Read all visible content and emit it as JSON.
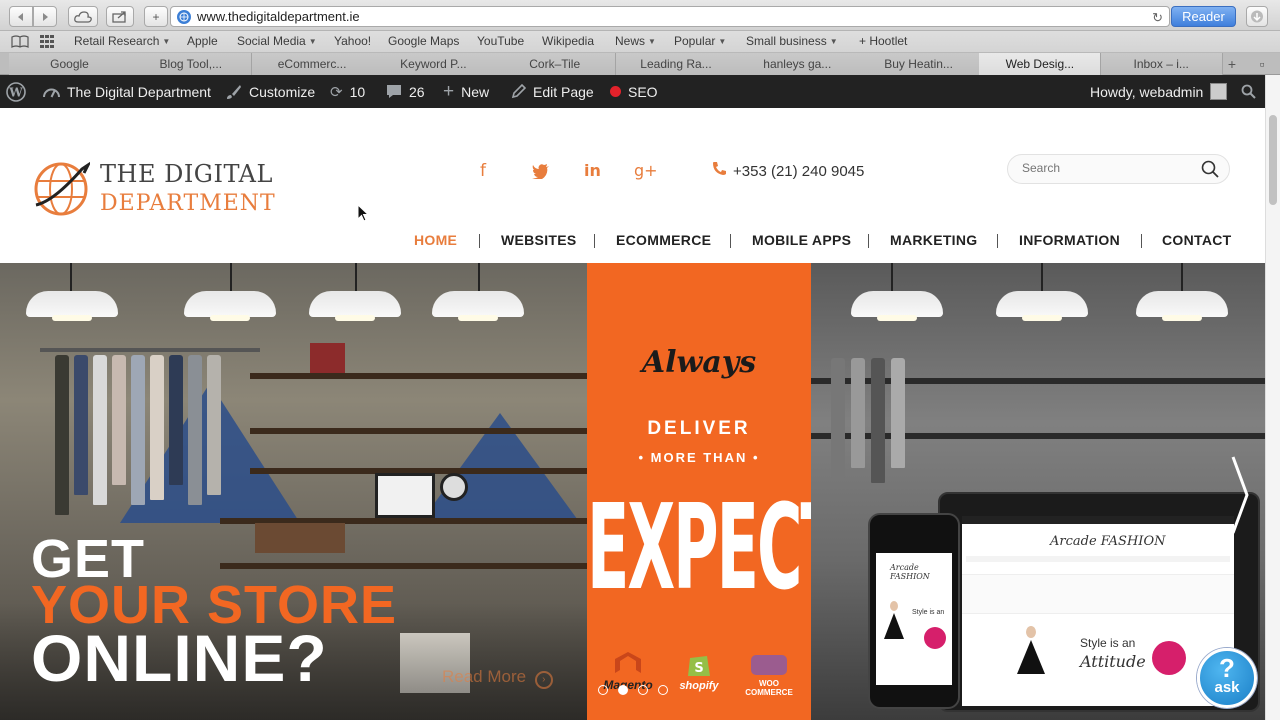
{
  "browser": {
    "url": "www.thedigitaldepartment.ie",
    "reader_label": "Reader",
    "bookmarks": [
      {
        "label": "Retail Research",
        "caret": true
      },
      {
        "label": "Apple",
        "caret": false
      },
      {
        "label": "Social Media",
        "caret": true
      },
      {
        "label": "Yahoo!",
        "caret": false
      },
      {
        "label": "Google Maps",
        "caret": false
      },
      {
        "label": "YouTube",
        "caret": false
      },
      {
        "label": "Wikipedia",
        "caret": false
      },
      {
        "label": "News",
        "caret": true
      },
      {
        "label": "Popular",
        "caret": true
      },
      {
        "label": "Small business",
        "caret": true
      },
      {
        "label": "+ Hootlet",
        "caret": false
      }
    ],
    "tabs": [
      "Google",
      "Blog Tool,...",
      "eCommerc...",
      "Keyword P...",
      "Cork–Tile",
      "Leading Ra...",
      "hanleys ga...",
      "Buy Heatin...",
      "Web Desig...",
      "Inbox – i..."
    ],
    "active_tab": 8
  },
  "adminbar": {
    "site_name": "The Digital Department",
    "customize": "Customize",
    "updates": "10",
    "comments": "26",
    "new": "New",
    "edit_page": "Edit Page",
    "seo": "SEO",
    "howdy": "Howdy, webadmin"
  },
  "header": {
    "logo_line1": "THE DIGITAL",
    "logo_line2": "DEPARTMENT",
    "phone": "+353 (21) 240 9045",
    "search_placeholder": "Search",
    "social": [
      "facebook",
      "twitter",
      "linkedin",
      "google-plus"
    ]
  },
  "nav": {
    "items": [
      "HOME",
      "WEBSITES",
      "ECOMMERCE",
      "MOBILE APPS",
      "MARKETING",
      "INFORMATION",
      "CONTACT"
    ],
    "active": 0
  },
  "hero": {
    "line1": "GET",
    "line2": "YOUR STORE",
    "line3": "ONLINE?",
    "read_more": "Read More",
    "always": "Always",
    "deliver": "DELIVER",
    "more_than": "• MORE THAN •",
    "expected": "EXPECTeD",
    "brands": [
      "Magento",
      "shopify",
      "WOO COMMERCE"
    ],
    "device_brand": "Arcade FASHION",
    "device_tagline": "Style is an",
    "device_tagline2": "Attitude",
    "slide_count": 4,
    "active_slide": 1
  },
  "ask_widget": {
    "q": "?",
    "label": "ask"
  },
  "colors": {
    "accent": "#e87d3d",
    "hero_orange": "#f26722",
    "adminbar": "#222222"
  }
}
